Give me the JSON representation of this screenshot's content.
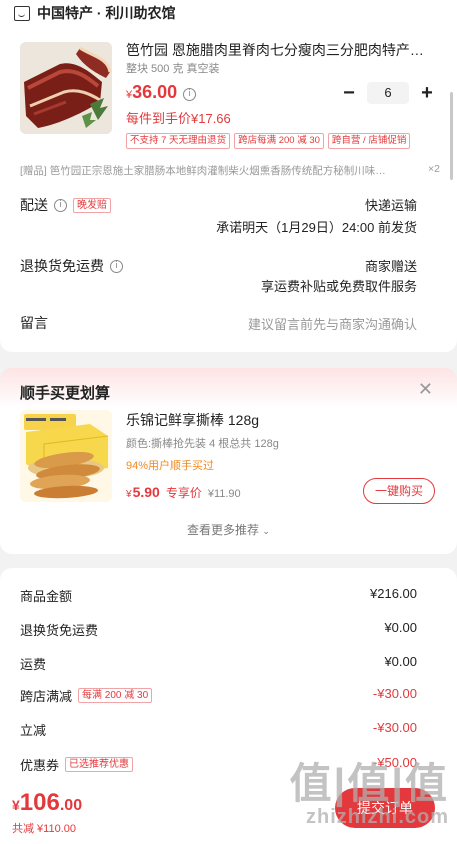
{
  "shop": {
    "name": "中国特产 · 利川助农馆"
  },
  "product": {
    "title": "笆竹园 恩施腊肉里脊肉七分瘦肉三分肥肉特产…",
    "spec": "整块 500 克 真空装",
    "price_symbol": "¥",
    "price": "36.00",
    "hand_price": "每件到手价¥17.66",
    "quantity": "6",
    "tags": [
      "不支持 7 天无理由退货",
      "跨店每满 200 减 30",
      "跨自营 / 店铺促销"
    ],
    "gift": "[赠品]  笆竹园正宗恩施土家腊肠本地鲜肉灌制柴火烟熏香肠传统配方秘制川味…",
    "gift_count": "×2"
  },
  "delivery": {
    "label": "配送",
    "badge": "晚发赔",
    "method": "快递运输",
    "promise": "承诺明天（1月29日）24:00 前发货"
  },
  "return_shipping": {
    "label": "退换货免运费",
    "value": "商家赠送",
    "sub": "享运费补贴或免费取件服务"
  },
  "message": {
    "label": "留言",
    "placeholder": "建议留言前先与商家沟通确认"
  },
  "recommend": {
    "title": "顺手买更划算",
    "name": "乐锦记鲜享撕棒 128g",
    "spec": "颜色:撕棒抢先装 4 根总共 128g",
    "buyers": "94%用户顺手买过",
    "price_symbol": "¥",
    "price": "5.90",
    "price_label": "专享价",
    "original_price": "¥11.90",
    "buy_label": "一键购买",
    "more_label": "查看更多推荐"
  },
  "summary": {
    "rows": [
      {
        "label": "商品金额",
        "value": "¥216.00"
      },
      {
        "label": "退换货免运费",
        "value": "¥0.00"
      },
      {
        "label": "运费",
        "value": "¥0.00"
      },
      {
        "label": "跨店满减",
        "badge": "每满 200 减 30",
        "value": "-¥30.00"
      },
      {
        "label": "立减",
        "value": "-¥30.00"
      },
      {
        "label": "优惠券",
        "badge": "已选推荐优惠",
        "value": "-¥50.00"
      }
    ]
  },
  "total": {
    "symbol": "¥",
    "amount": "106",
    "decimal": ".00",
    "saved": "共减 ¥110.00",
    "submit_label": "提交订单"
  },
  "watermark": {
    "big": "值|值|值",
    "small": "zhizhizhi.com"
  },
  "colors": {
    "accent": "#e4393c",
    "badge_orange": "#f08a24",
    "background": "#f2f2f2"
  }
}
